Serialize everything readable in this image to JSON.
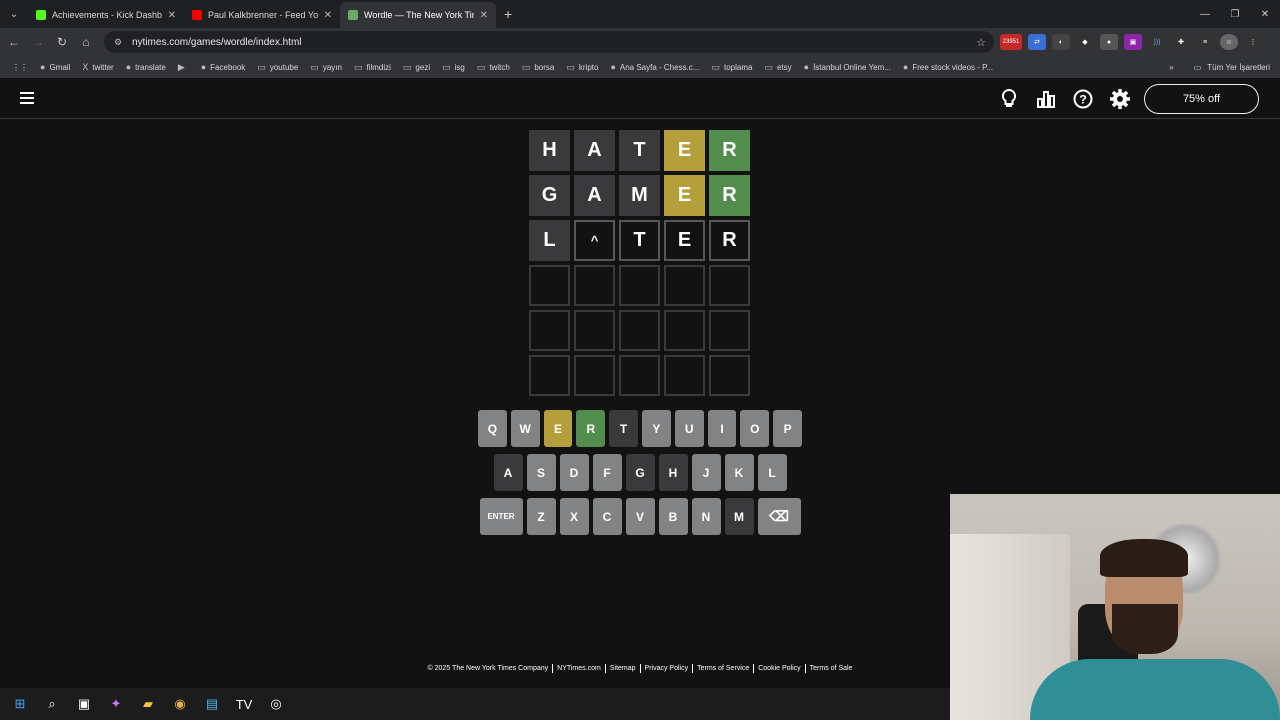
{
  "browser": {
    "tabs": [
      {
        "title": "Achievements - Kick Dashboard",
        "icon": "kick-favicon",
        "color": "#53fc18",
        "active": false
      },
      {
        "title": "Paul Kalkbrenner - Feed Yo",
        "icon": "youtube-favicon",
        "color": "#ff0000",
        "active": false
      },
      {
        "title": "Wordle — The New York Times",
        "icon": "wordle-favicon",
        "color": "#6aaa64",
        "active": true
      }
    ],
    "url": "nytimes.com/games/wordle/index.html",
    "extension_badge": "23951",
    "bookmarks": [
      {
        "label": "Gmail",
        "icon": "gmail-icon"
      },
      {
        "label": "twitter",
        "icon": "x-icon"
      },
      {
        "label": "translate",
        "icon": "translate-icon"
      },
      {
        "label": "",
        "icon": "youtube-icon"
      },
      {
        "label": "Facebook",
        "icon": "facebook-icon"
      },
      {
        "label": "youtube",
        "icon": "folder-icon"
      },
      {
        "label": "yayın",
        "icon": "folder-icon"
      },
      {
        "label": "filmdizi",
        "icon": "folder-icon"
      },
      {
        "label": "gezi",
        "icon": "folder-icon"
      },
      {
        "label": "isg",
        "icon": "folder-icon"
      },
      {
        "label": "twitch",
        "icon": "folder-icon"
      },
      {
        "label": "borsa",
        "icon": "folder-icon"
      },
      {
        "label": "kripto",
        "icon": "folder-icon"
      },
      {
        "label": "Ana Sayfa - Chess.c...",
        "icon": "chess-icon"
      },
      {
        "label": "toplama",
        "icon": "folder-icon"
      },
      {
        "label": "etsy",
        "icon": "folder-icon"
      },
      {
        "label": "İstanbul Online Yem...",
        "icon": "yemek-icon"
      },
      {
        "label": "Free stock videos - P...",
        "icon": "pexels-icon"
      }
    ],
    "all_bookmarks": "Tüm Yer İşaretleri"
  },
  "game": {
    "offer_label": "75% off",
    "board": [
      [
        {
          "l": "H",
          "s": "absent"
        },
        {
          "l": "A",
          "s": "absent"
        },
        {
          "l": "T",
          "s": "absent"
        },
        {
          "l": "E",
          "s": "present"
        },
        {
          "l": "R",
          "s": "correct"
        }
      ],
      [
        {
          "l": "G",
          "s": "absent"
        },
        {
          "l": "A",
          "s": "absent"
        },
        {
          "l": "M",
          "s": "absent"
        },
        {
          "l": "E",
          "s": "present"
        },
        {
          "l": "R",
          "s": "correct"
        }
      ],
      [
        {
          "l": "L",
          "s": "absent"
        },
        {
          "l": "^",
          "s": "tbd"
        },
        {
          "l": "T",
          "s": "tbd"
        },
        {
          "l": "E",
          "s": "tbd"
        },
        {
          "l": "R",
          "s": "tbd"
        }
      ],
      [
        {
          "l": "",
          "s": "empty"
        },
        {
          "l": "",
          "s": "empty"
        },
        {
          "l": "",
          "s": "empty"
        },
        {
          "l": "",
          "s": "empty"
        },
        {
          "l": "",
          "s": "empty"
        }
      ],
      [
        {
          "l": "",
          "s": "empty"
        },
        {
          "l": "",
          "s": "empty"
        },
        {
          "l": "",
          "s": "empty"
        },
        {
          "l": "",
          "s": "empty"
        },
        {
          "l": "",
          "s": "empty"
        }
      ],
      [
        {
          "l": "",
          "s": "empty"
        },
        {
          "l": "",
          "s": "empty"
        },
        {
          "l": "",
          "s": "empty"
        },
        {
          "l": "",
          "s": "empty"
        },
        {
          "l": "",
          "s": "empty"
        }
      ]
    ],
    "keyboard": [
      [
        {
          "k": "Q",
          "s": ""
        },
        {
          "k": "W",
          "s": ""
        },
        {
          "k": "E",
          "s": "present"
        },
        {
          "k": "R",
          "s": "correct"
        },
        {
          "k": "T",
          "s": "absent"
        },
        {
          "k": "Y",
          "s": ""
        },
        {
          "k": "U",
          "s": ""
        },
        {
          "k": "I",
          "s": ""
        },
        {
          "k": "O",
          "s": ""
        },
        {
          "k": "P",
          "s": ""
        }
      ],
      [
        {
          "k": "A",
          "s": "absent"
        },
        {
          "k": "S",
          "s": ""
        },
        {
          "k": "D",
          "s": ""
        },
        {
          "k": "F",
          "s": ""
        },
        {
          "k": "G",
          "s": "absent"
        },
        {
          "k": "H",
          "s": "absent"
        },
        {
          "k": "J",
          "s": ""
        },
        {
          "k": "K",
          "s": ""
        },
        {
          "k": "L",
          "s": ""
        }
      ],
      [
        {
          "k": "ENTER",
          "s": "",
          "wide": true
        },
        {
          "k": "Z",
          "s": ""
        },
        {
          "k": "X",
          "s": ""
        },
        {
          "k": "C",
          "s": ""
        },
        {
          "k": "V",
          "s": ""
        },
        {
          "k": "B",
          "s": ""
        },
        {
          "k": "N",
          "s": ""
        },
        {
          "k": "M",
          "s": "absent"
        },
        {
          "k": "⌫",
          "s": "",
          "wide": true
        }
      ]
    ]
  },
  "footer": [
    "© 2025 The New York Times Company",
    "NYTimes.com",
    "Sitemap",
    "Privacy Policy",
    "Terms of Service",
    "Cookie Policy",
    "Terms of Sale"
  ],
  "colors": {
    "correct": "#538d4e",
    "present": "#b59f3b",
    "absent": "#3a3a3c",
    "key_default": "#818384"
  }
}
